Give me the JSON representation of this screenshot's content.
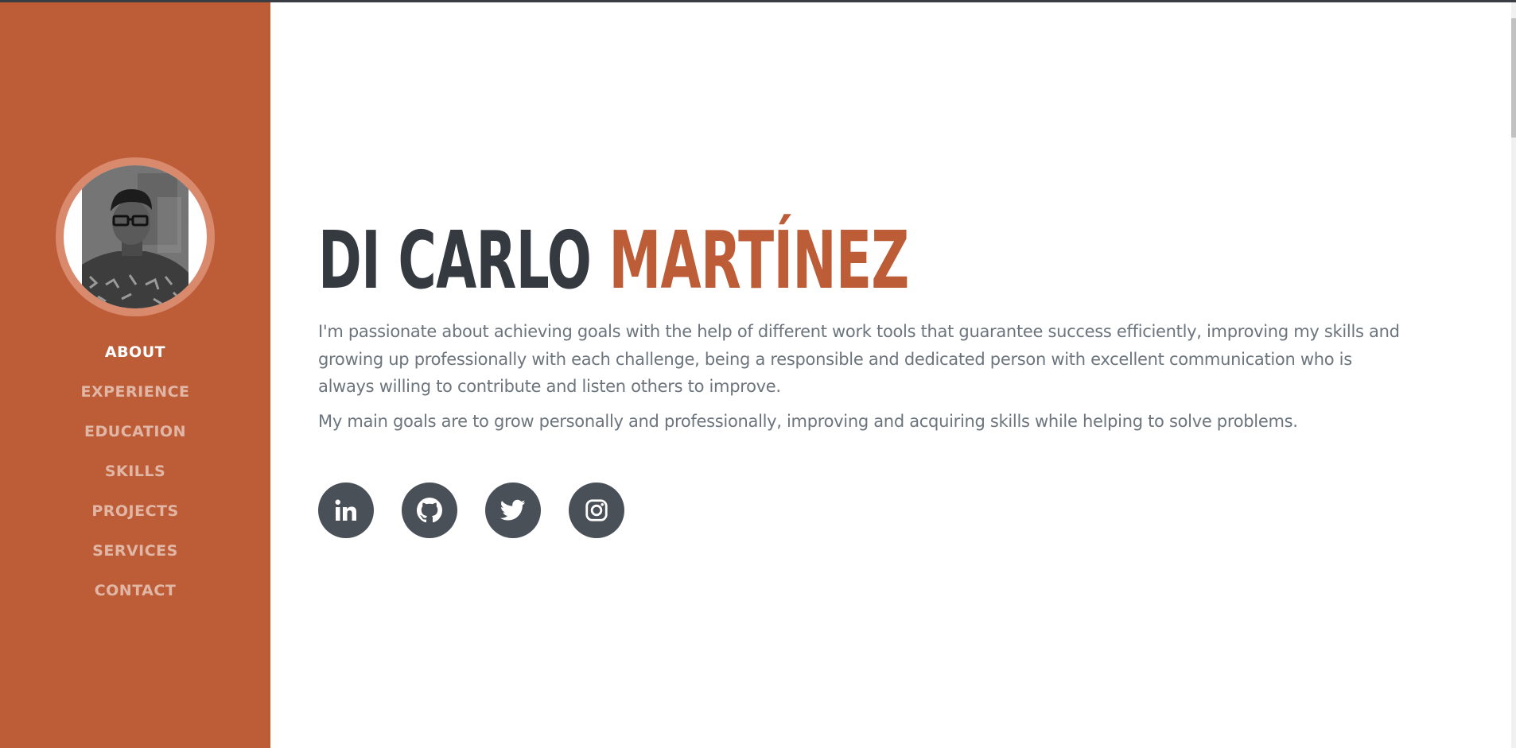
{
  "profile": {
    "first_name": "DI CARLO",
    "last_name": "MARTÍNEZ",
    "bio": "I'm passionate about achieving goals with the help of different work tools that guarantee success efficiently, improving my skills and growing up professionally with each challenge, being a responsible and dedicated person with excellent communication who is always willing to contribute and listen others to improve.",
    "goals": "My main goals are to grow personally and professionally, improving and acquiring skills while helping to solve problems."
  },
  "nav": {
    "items": [
      {
        "label": "ABOUT",
        "active": true
      },
      {
        "label": "EXPERIENCE"
      },
      {
        "label": "EDUCATION"
      },
      {
        "label": "SKILLS"
      },
      {
        "label": "PROJECTS"
      },
      {
        "label": "SERVICES"
      },
      {
        "label": "CONTACT"
      }
    ]
  },
  "socials": [
    {
      "icon": "linkedin-icon"
    },
    {
      "icon": "github-icon"
    },
    {
      "icon": "twitter-icon"
    },
    {
      "icon": "instagram-icon"
    }
  ],
  "colors": {
    "primary": "#bd5d38",
    "dark": "#343a40",
    "text": "#6c757d",
    "social_bg": "#495057"
  }
}
